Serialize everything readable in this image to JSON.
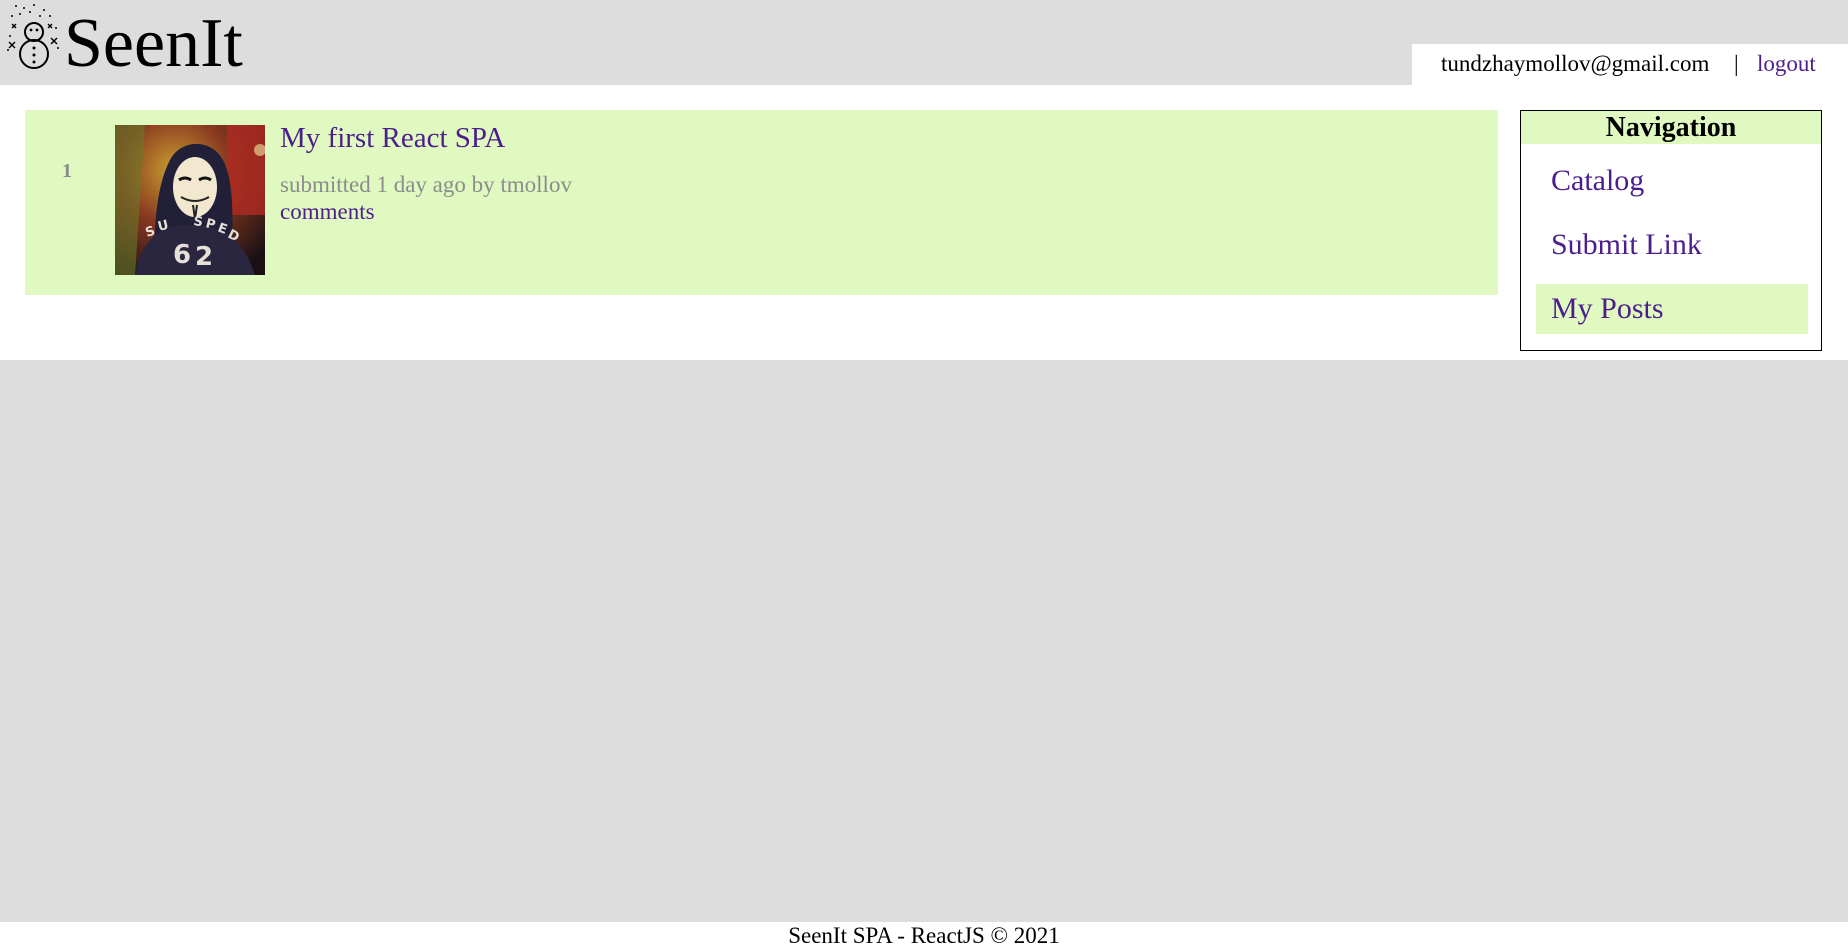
{
  "header": {
    "brand": "SeenIt",
    "logo_icon": "snowman-icon",
    "user_email": "tundzhaymollov@gmail.com",
    "separator": "|",
    "logout_label": "logout"
  },
  "posts": [
    {
      "rank": "1",
      "thumbnail": "guy-fawkes-mask-hoodie-photo",
      "title": "My first React SPA",
      "meta": "submitted 1 day ago by tmollov",
      "comments_label": "comments"
    }
  ],
  "navigation": {
    "title": "Navigation",
    "items": [
      {
        "label": "Catalog",
        "active": false
      },
      {
        "label": "Submit Link",
        "active": false
      },
      {
        "label": "My Posts",
        "active": true
      }
    ]
  },
  "footer": {
    "text": "SeenIt SPA - ReactJS © 2021"
  },
  "colors": {
    "page_bg": "#dddddd",
    "accent_green": "#dff9c0",
    "link_purple": "#4b1e8c",
    "muted_gray": "#8c8c8c"
  }
}
